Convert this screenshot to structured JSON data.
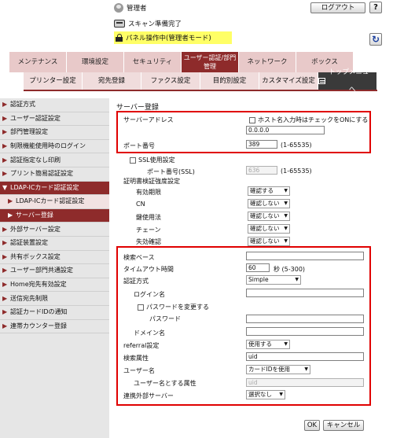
{
  "header": {
    "user": "管理者",
    "logout": "ログアウト",
    "help": "?",
    "status": "スキャン準備完了",
    "mode": "パネル操作中(管理者モード)"
  },
  "tabs_main": [
    "メンテナンス",
    "環境設定",
    "セキュリティ",
    "ユーザー認証/部門管理",
    "ネットワーク",
    "ボックス"
  ],
  "tabs_sub": [
    "プリンター設定",
    "宛先登録",
    "ファクス設定",
    "目的別設定",
    "カスタマイズ設定",
    "トップメニューへ"
  ],
  "sidebar": {
    "items": [
      "認証方式",
      "ユーザー認証設定",
      "部門管理設定",
      "制限機能使用時のログイン",
      "認証指定なし印刷",
      "プリント簡易認証設定",
      "LDAP-ICカード認証設定",
      "LDAP-ICカード認証設定",
      "サーバー登録",
      "外部サーバー設定",
      "認証装置設定",
      "共有ボックス設定",
      "ユーザー部門共通設定",
      "Home宛先有効設定",
      "送信宛先制限",
      "認証カードIDの通知",
      "連帯カウンター登録"
    ]
  },
  "main": {
    "title": "サーバー登録",
    "server_address_label": "サーバーアドレス",
    "host_check_label": "ホスト名入力時はチェックをONにする",
    "server_address_value": "0.0.0.0",
    "port_label": "ポート番号",
    "port_value": "389",
    "port_range": "(1-65535)",
    "ssl_label": "SSL使用設定",
    "ssl_port_label": "ポート番号(SSL)",
    "ssl_port_value": "636",
    "ssl_port_range": "(1-65535)",
    "cert_label": "証明書検証強度設定",
    "expiry_label": "有効期限",
    "expiry_value": "確認する",
    "cn_label": "CN",
    "cn_value": "確認しない",
    "keyuse_label": "鍵使用法",
    "keyuse_value": "確認しない",
    "chain_label": "チェーン",
    "chain_value": "確認しない",
    "revoke_label": "失効確認",
    "revoke_value": "確認しない",
    "searchbase_label": "検索ベース",
    "searchbase_value": "",
    "timeout_label": "タイムアウト時間",
    "timeout_value": "60",
    "timeout_unit": "秒 (5-300)",
    "auth_label": "認証方式",
    "auth_value": "Simple",
    "login_label": "ログイン名",
    "login_value": "",
    "change_pw_label": "パスワードを変更する",
    "password_label": "パスワード",
    "password_value": "",
    "domain_label": "ドメイン名",
    "domain_value": "",
    "referral_label": "referral設定",
    "referral_value": "使用する",
    "search_attr_label": "検索属性",
    "search_attr_value": "uid",
    "username_label": "ユーザー名",
    "username_value": "カードIDを使用",
    "username_attr_label": "ユーザー名とする属性",
    "username_attr_value": "uid",
    "ext_server_label": "連携外部サーバー",
    "ext_server_value": "選択なし"
  },
  "footer": {
    "ok": "OK",
    "cancel": "キャンセル"
  },
  "colors": {
    "accent": "#8e2b2b",
    "highlight": "#e00000",
    "mode_bg": "#ffff66"
  }
}
